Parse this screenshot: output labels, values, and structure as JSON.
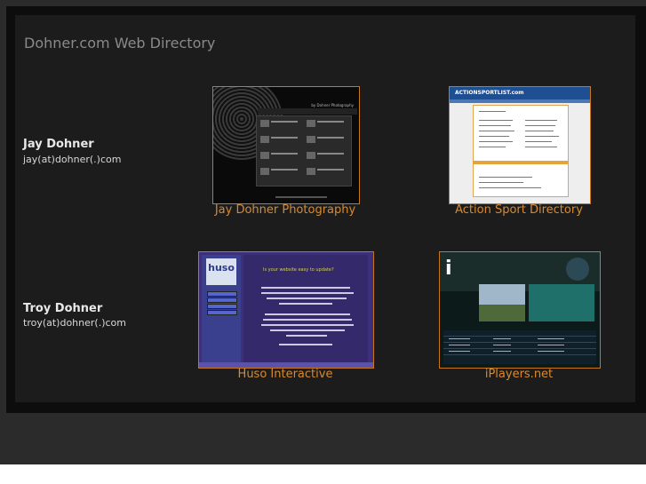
{
  "directory": {
    "title": "Dohner.com Web Directory"
  },
  "people": [
    {
      "name": "Jay Dohner",
      "email": "jay(at)dohner(.)com",
      "sites": [
        {
          "caption": "Jay Dohner Photography",
          "thumb_text": "by Dohner Photography"
        },
        {
          "caption": "Action Sport Directory",
          "thumb_text": "ACTIONSPORTLIST.com"
        }
      ]
    },
    {
      "name": "Troy Dohner",
      "email": "troy(at)dohner(.)com",
      "sites": [
        {
          "caption": "Huso Interactive",
          "thumb_text": "huso",
          "thumb_subtext": "Is your website easy to update?"
        },
        {
          "caption": "iPlayers.net",
          "thumb_text": "i"
        }
      ]
    }
  ],
  "colors": {
    "background": "#1c1c1c",
    "accent": "#d98a2e",
    "title": "#8a8a8a"
  }
}
